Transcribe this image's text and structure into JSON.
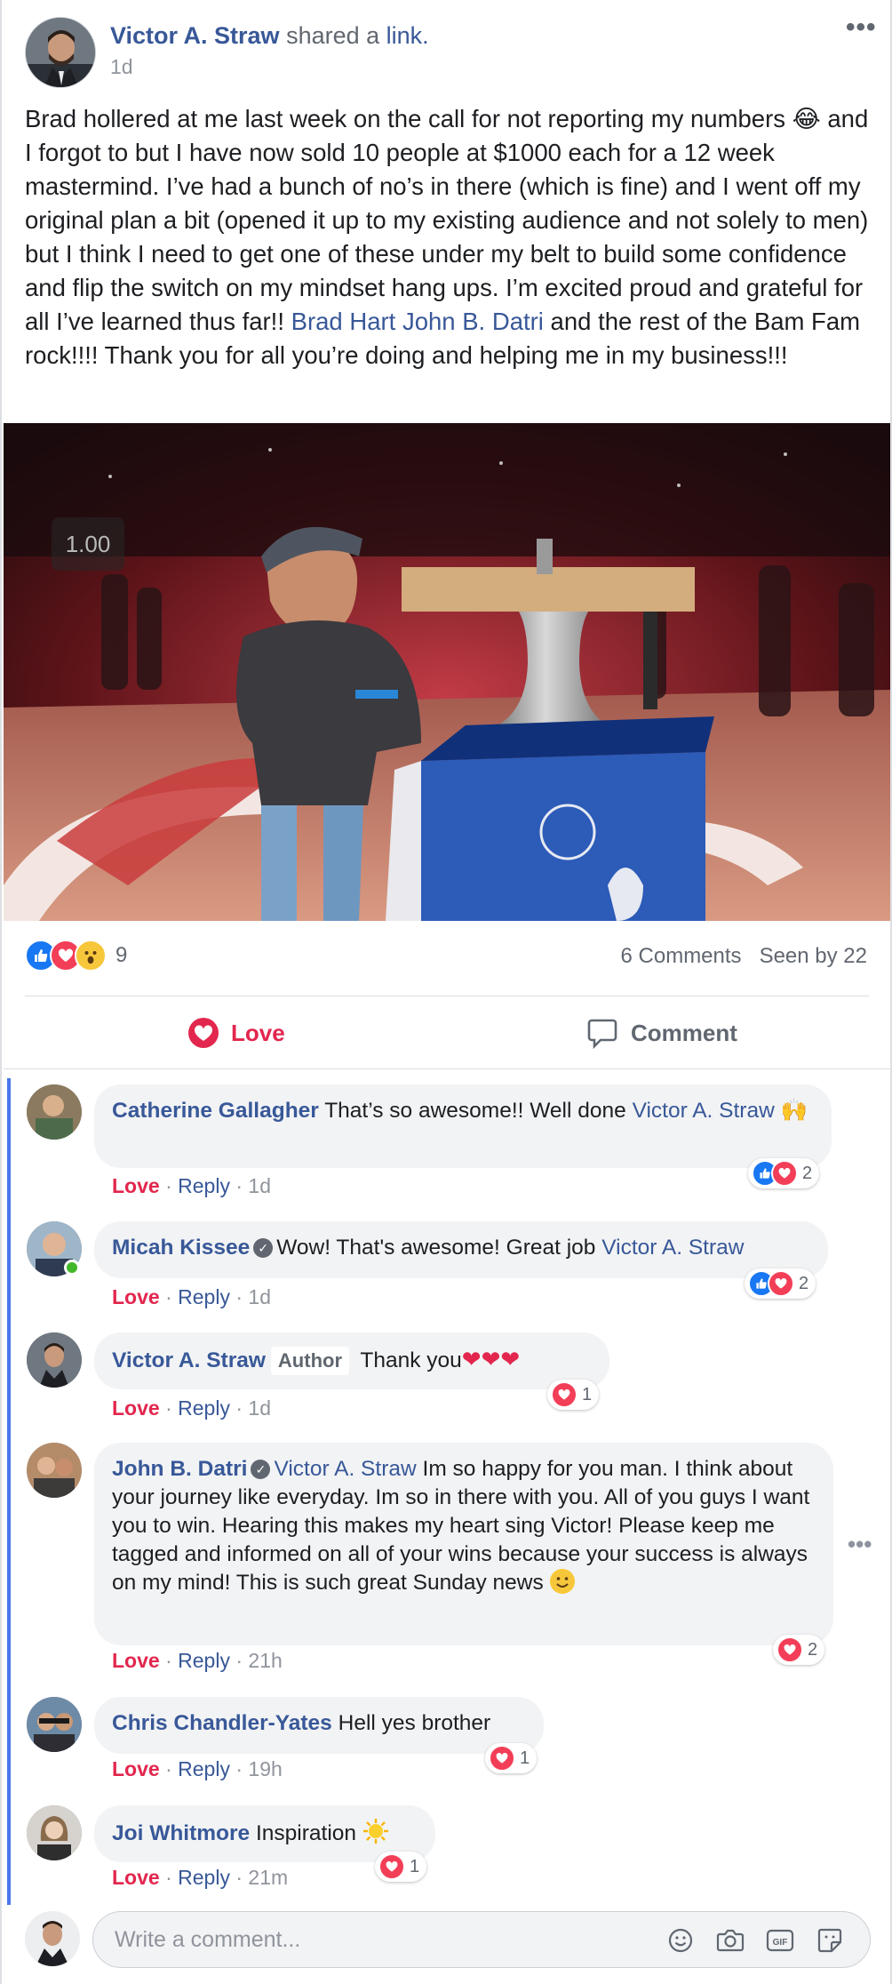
{
  "post": {
    "author": "Victor A. Straw",
    "action_text": "shared a",
    "action_link": "link.",
    "time": "1d",
    "more": "•••",
    "body_pre": "Brad hollered at me last week on the call for not reporting my numbers 😂 and I forgot to but I have now sold 10 people at $1000 each for a 12 week mastermind. I’ve had a bunch of no’s in there (which is fine) and I went off my original plan a bit (opened it up to my existing audience and not solely to men) but I think I need to get one of these under my belt to build some confidence and flip the switch on my mindset hang ups. I’m excited proud and grateful for all I’ve learned thus far!! ",
    "mention1": "Brad Hart",
    "mention2": "John B. Datri",
    "body_post": " and the rest of the Bam Fam rock!!!! Thank you for all you’re doing and helping me in my business!!!",
    "media": {
      "speed": "1.00"
    },
    "reaction_count": "9",
    "comments_count": "6 Comments",
    "seen_by": "Seen by 22",
    "actions": {
      "love": "Love",
      "comment": "Comment"
    }
  },
  "comments": [
    {
      "author": "Catherine Gallagher",
      "text": "That’s so awesome!! Well done ",
      "mention": "Victor A. Straw",
      "emoji": "🙌",
      "react_label": "Love",
      "reply_label": "Reply",
      "time": "1d",
      "reaction_count": "2"
    },
    {
      "author": "Micah Kissee",
      "text": "Wow! That's awesome! Great job ",
      "mention": "Victor A. Straw",
      "react_label": "Love",
      "reply_label": "Reply",
      "time": "1d",
      "reaction_count": "2"
    },
    {
      "author": "Victor A. Straw",
      "badge": "Author",
      "text": "Thank you",
      "hearts": "❤❤❤",
      "react_label": "Love",
      "reply_label": "Reply",
      "time": "1d",
      "reaction_count": "1"
    },
    {
      "author": "John B. Datri",
      "mention": "Victor A. Straw",
      "text": " Im so happy for you man. I think about your journey like everyday. Im so in there with you. All of you guys I want you to win. Hearing this makes my heart sing Victor! Please keep me tagged and informed on all of your wins because your success is always on my mind! This is such great Sunday news ",
      "react_label": "Love",
      "reply_label": "Reply",
      "time": "21h",
      "reaction_count": "2",
      "more": "•••"
    },
    {
      "author": "Chris Chandler-Yates",
      "text": "Hell yes brother",
      "react_label": "Love",
      "reply_label": "Reply",
      "time": "19h",
      "reaction_count": "1"
    },
    {
      "author": "Joi Whitmore",
      "text": "Inspiration ",
      "react_label": "Love",
      "reply_label": "Reply",
      "time": "21m",
      "reaction_count": "1"
    }
  ],
  "separator": "·",
  "composer": {
    "placeholder": "Write a comment..."
  },
  "icons": [
    "like-icon",
    "love-icon",
    "wow-icon",
    "heart-outline-icon",
    "speech-bubble-icon",
    "smiley-icon",
    "camera-icon",
    "gif-icon",
    "sticker-icon",
    "verified-icon",
    "more-icon"
  ],
  "colors": {
    "link": "#385898",
    "love": "#e2264d",
    "like": "#1877f2",
    "thread": "#4a76e8"
  }
}
